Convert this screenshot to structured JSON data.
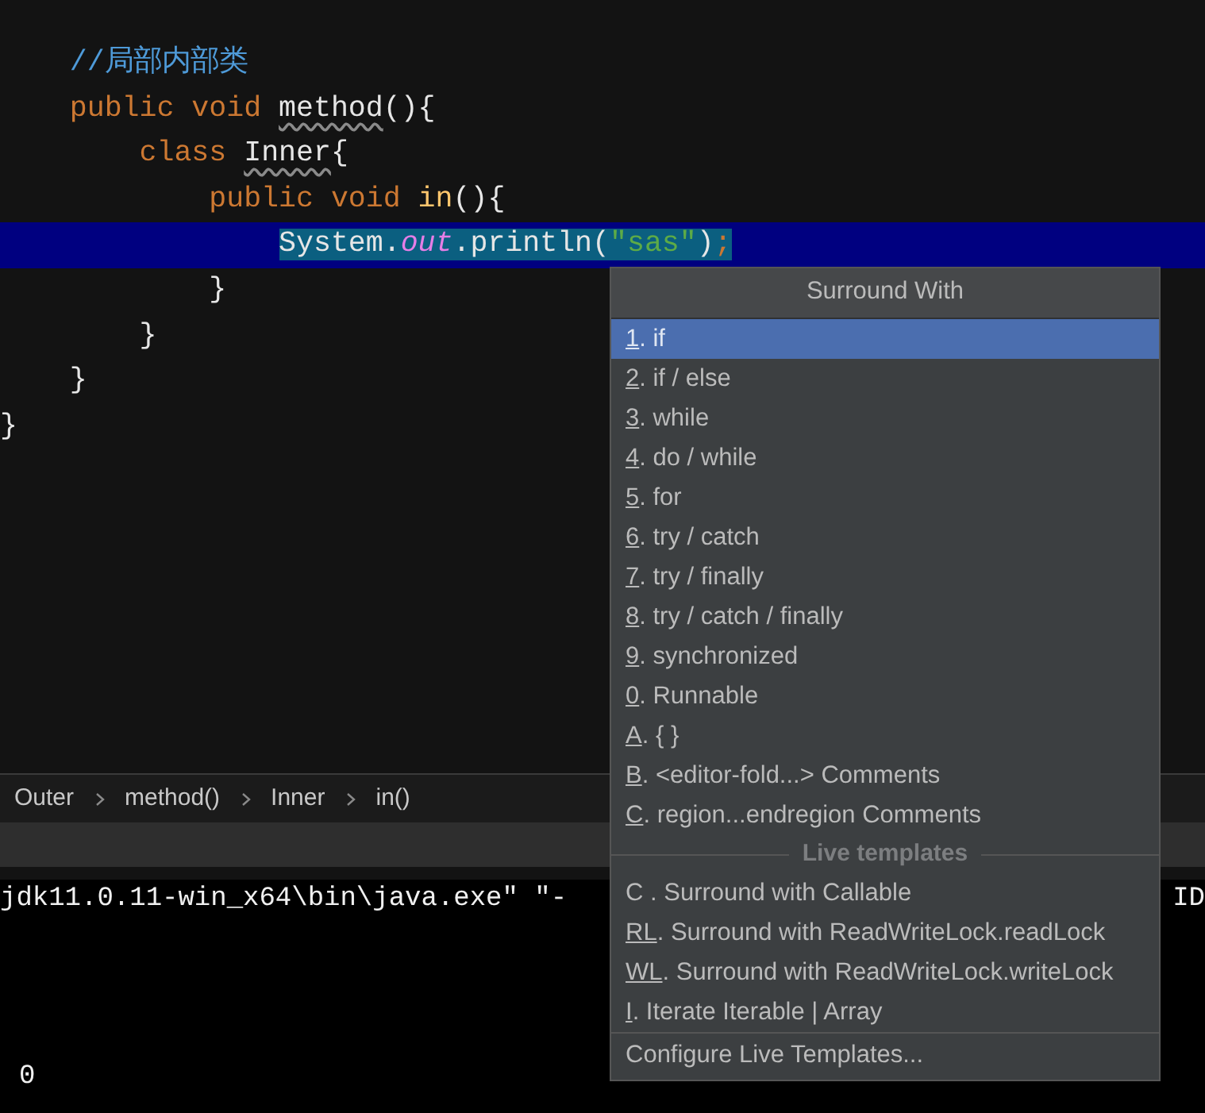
{
  "editor": {
    "lines": [
      {
        "highlighted": false,
        "tokens": [
          {
            "text": "    //局部内部类",
            "kind": "comment"
          }
        ]
      },
      {
        "highlighted": false,
        "tokens": [
          {
            "text": "    public void ",
            "kind": "keyword"
          },
          {
            "text": "method",
            "kind": "plain",
            "warning": true
          },
          {
            "text": "(){",
            "kind": "plain"
          }
        ]
      },
      {
        "highlighted": false,
        "tokens": [
          {
            "text": "        class ",
            "kind": "keyword"
          },
          {
            "text": "Inner",
            "kind": "plain",
            "warning": true
          },
          {
            "text": "{",
            "kind": "plain"
          }
        ]
      },
      {
        "highlighted": false,
        "tokens": [
          {
            "text": "            public void ",
            "kind": "keyword"
          },
          {
            "text": "in",
            "kind": "method"
          },
          {
            "text": "(){",
            "kind": "plain"
          }
        ]
      },
      {
        "highlighted": true,
        "tokens": [
          {
            "text": "                System.",
            "kind": "plain",
            "selected": true
          },
          {
            "text": "out",
            "kind": "field",
            "selected": true
          },
          {
            "text": ".println(",
            "kind": "plain",
            "selected": true
          },
          {
            "text": "\"sas\"",
            "kind": "string",
            "selected": true
          },
          {
            "text": ")",
            "kind": "plain",
            "selected": true
          },
          {
            "text": ";",
            "kind": "keyword",
            "selected": true
          }
        ]
      },
      {
        "highlighted": false,
        "tokens": [
          {
            "text": "            }",
            "kind": "plain"
          }
        ]
      },
      {
        "highlighted": false,
        "tokens": [
          {
            "text": "        }",
            "kind": "plain"
          }
        ]
      },
      {
        "highlighted": false,
        "tokens": [
          {
            "text": "    }",
            "kind": "plain"
          }
        ]
      },
      {
        "highlighted": false,
        "tokens": [
          {
            "text": "}",
            "kind": "plain"
          }
        ]
      }
    ]
  },
  "breadcrumbs": [
    "Outer",
    "method()",
    "Inner",
    "in()"
  ],
  "console": {
    "line_1": "jdk11.0.11-win_x64\\bin\\java.exe\" \"-",
    "line_1_right": "ID",
    "line_2": "0"
  },
  "popup": {
    "title": "Surround With",
    "items": [
      {
        "mnemonic": "1",
        "text": ". if",
        "selected": true
      },
      {
        "mnemonic": "2",
        "text": ". if / else",
        "selected": false
      },
      {
        "mnemonic": "3",
        "text": ". while",
        "selected": false
      },
      {
        "mnemonic": "4",
        "text": ". do / while",
        "selected": false
      },
      {
        "mnemonic": "5",
        "text": ". for",
        "selected": false
      },
      {
        "mnemonic": "6",
        "text": ". try / catch",
        "selected": false
      },
      {
        "mnemonic": "7",
        "text": ". try / finally",
        "selected": false
      },
      {
        "mnemonic": "8",
        "text": ". try / catch / finally",
        "selected": false
      },
      {
        "mnemonic": "9",
        "text": ". synchronized",
        "selected": false
      },
      {
        "mnemonic": "0",
        "text": ". Runnable",
        "selected": false
      },
      {
        "mnemonic": "A",
        "text": ". { }",
        "selected": false
      },
      {
        "mnemonic": "B",
        "text": ". <editor-fold...> Comments",
        "selected": false
      },
      {
        "mnemonic": "C",
        "text": ". region...endregion Comments",
        "selected": false
      }
    ],
    "live_templates_title": "Live templates",
    "live_templates": [
      {
        "text": "C . Surround with Callable",
        "selected": false
      },
      {
        "mnemonic": "RL",
        "text": ". Surround with ReadWriteLock.readLock",
        "selected": false
      },
      {
        "mnemonic": "WL",
        "text": ". Surround with ReadWriteLock.writeLock",
        "selected": false
      },
      {
        "mnemonic": "I",
        "text": ". Iterate Iterable | Array",
        "selected": false
      }
    ],
    "footer": "Configure Live Templates..."
  }
}
